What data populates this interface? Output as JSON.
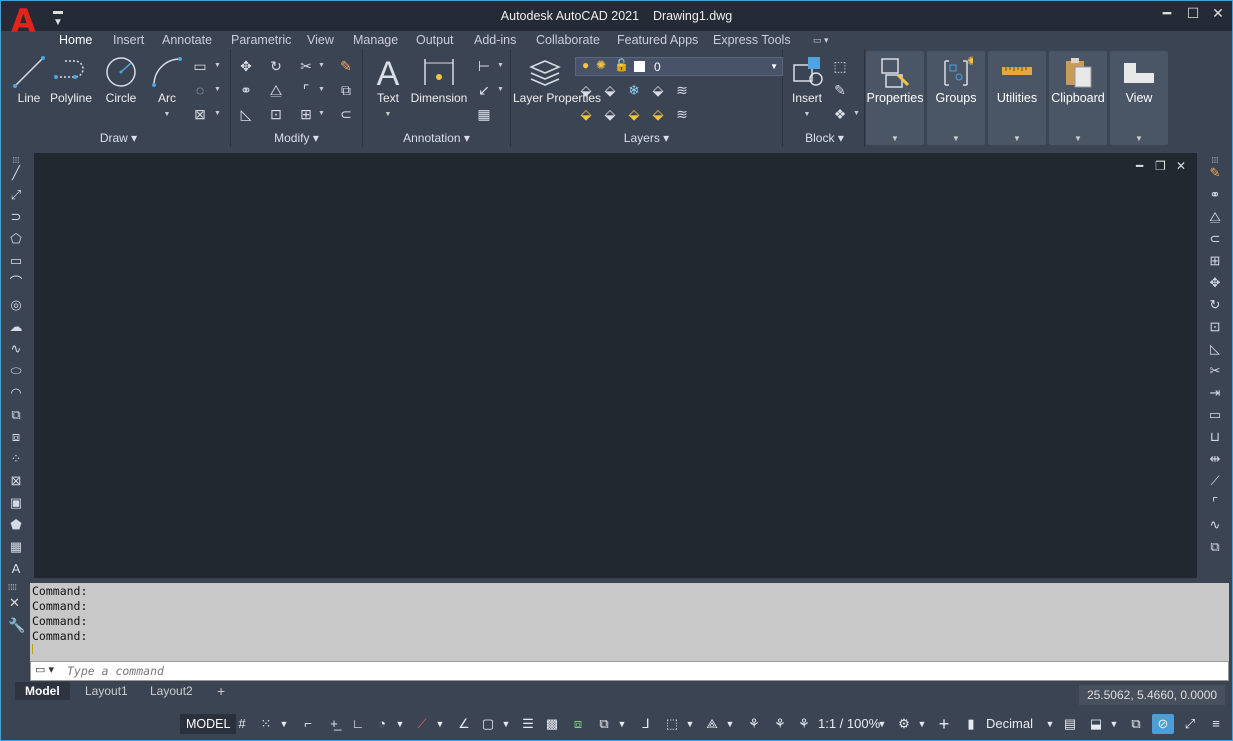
{
  "app": {
    "title": "Autodesk AutoCAD 2021    Drawing1.dwg",
    "logo": "A",
    "qat_icon": "dropdown-menu-icon"
  },
  "window_controls": [
    "minimize-icon",
    "maximize-icon",
    "close-icon"
  ],
  "ribbon_tabs": [
    "Home",
    "Insert",
    "Annotate",
    "Parametric",
    "View",
    "Manage",
    "Output",
    "Add-ins",
    "Collaborate",
    "Featured Apps",
    "Express Tools"
  ],
  "active_tab": "Home",
  "ribbon": {
    "draw": {
      "title": "Draw",
      "line": "Line",
      "polyline": "Polyline",
      "circle": "Circle",
      "arc": "Arc"
    },
    "modify": {
      "title": "Modify"
    },
    "annotation": {
      "title": "Annotation",
      "text": "Text",
      "dimension": "Dimension"
    },
    "layers": {
      "title": "Layers",
      "layer_properties": "Layer Properties",
      "current_layer": "0",
      "accent": "#f5c542"
    },
    "block": {
      "title": "Block",
      "insert": "Insert"
    },
    "groups": [
      {
        "label": "Properties",
        "icon": "properties-icon"
      },
      {
        "label": "Groups",
        "icon": "groups-icon"
      },
      {
        "label": "Utilities",
        "icon": "utilities-icon"
      },
      {
        "label": "Clipboard",
        "icon": "clipboard-icon"
      },
      {
        "label": "View",
        "icon": "view-icon"
      }
    ]
  },
  "command": {
    "history": [
      "Command:",
      "Command:",
      "Command:",
      "Command:"
    ],
    "placeholder": "Type a command"
  },
  "layout_tabs": [
    "Model",
    "Layout1",
    "Layout2"
  ],
  "active_layout": "Model",
  "coordinates": "25.5062, 5.4660, 0.0000",
  "status": {
    "model": "MODEL",
    "scale": "1:1 / 100%",
    "units": "Decimal"
  },
  "colors": {
    "canvas": "#212830",
    "ribbon": "#3b4453",
    "titlebar": "#252b36",
    "logo": "#e2231a",
    "command_bg": "#c8c8c8"
  }
}
